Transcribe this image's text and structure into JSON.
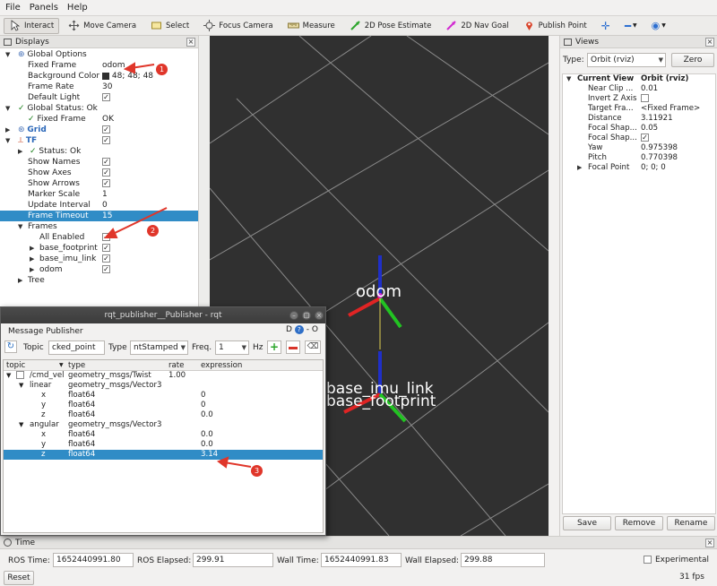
{
  "menu": [
    "File",
    "Panels",
    "Help"
  ],
  "toolbar": {
    "tools": [
      {
        "label": "Interact",
        "icon": "interact-icon"
      },
      {
        "label": "Move Camera",
        "icon": "move-camera-icon"
      },
      {
        "label": "Select",
        "icon": "select-icon"
      },
      {
        "label": "Focus Camera",
        "icon": "focus-camera-icon"
      },
      {
        "label": "Measure",
        "icon": "measure-icon"
      },
      {
        "label": "2D Pose Estimate",
        "icon": "pose-estimate-icon"
      },
      {
        "label": "2D Nav Goal",
        "icon": "nav-goal-icon"
      },
      {
        "label": "Publish Point",
        "icon": "publish-point-icon"
      }
    ]
  },
  "displays": {
    "title": "Displays",
    "rows": [
      {
        "key": "Global Options",
        "value": ""
      },
      {
        "key": "Fixed Frame",
        "value": "odom"
      },
      {
        "key": "Background Color",
        "value": "48; 48; 48"
      },
      {
        "key": "Frame Rate",
        "value": "30"
      },
      {
        "key": "Default Light",
        "value": ""
      },
      {
        "key": "Global Status: Ok",
        "value": ""
      },
      {
        "key": "Fixed Frame",
        "value": "OK"
      },
      {
        "key": "Grid",
        "value": ""
      },
      {
        "key": "TF",
        "value": ""
      },
      {
        "key": "Status: Ok",
        "value": ""
      },
      {
        "key": "Show Names",
        "value": ""
      },
      {
        "key": "Show Axes",
        "value": ""
      },
      {
        "key": "Show Arrows",
        "value": ""
      },
      {
        "key": "Marker Scale",
        "value": "1"
      },
      {
        "key": "Update Interval",
        "value": "0"
      },
      {
        "key": "Frame Timeout",
        "value": "15"
      },
      {
        "key": "Frames",
        "value": ""
      },
      {
        "key": "All Enabled",
        "value": ""
      },
      {
        "key": "base_footprint",
        "value": ""
      },
      {
        "key": "base_imu_link",
        "value": ""
      },
      {
        "key": "odom",
        "value": ""
      },
      {
        "key": "Tree",
        "value": ""
      }
    ]
  },
  "scene": {
    "labels": [
      "odom",
      "base_imu_link",
      "base_footprint"
    ]
  },
  "views": {
    "title": "Views",
    "type_label": "Type:",
    "type_value": "Orbit (rviz)",
    "zero_label": "Zero",
    "rows": [
      {
        "key": "Current View",
        "value": "Orbit (rviz)"
      },
      {
        "key": "Near Clip ...",
        "value": "0.01"
      },
      {
        "key": "Invert Z Axis",
        "value": ""
      },
      {
        "key": "Target Fra...",
        "value": "<Fixed Frame>"
      },
      {
        "key": "Distance",
        "value": "3.11921"
      },
      {
        "key": "Focal Shap...",
        "value": "0.05"
      },
      {
        "key": "Focal Shap...",
        "value": ""
      },
      {
        "key": "Yaw",
        "value": "0.975398"
      },
      {
        "key": "Pitch",
        "value": "0.770398"
      },
      {
        "key": "Focal Point",
        "value": "0; 0; 0"
      }
    ],
    "save_label": "Save",
    "remove_label": "Remove",
    "rename_label": "Rename"
  },
  "time": {
    "title": "Time",
    "ros_time_label": "ROS Time:",
    "ros_time": "1652440991.80",
    "ros_elapsed_label": "ROS Elapsed:",
    "ros_elapsed": "299.91",
    "wall_time_label": "Wall Time:",
    "wall_time": "1652440991.83",
    "wall_elapsed_label": "Wall Elapsed:",
    "wall_elapsed": "299.88",
    "experimental_label": "Experimental",
    "reset_label": "Reset",
    "fps": "31 fps"
  },
  "rqt": {
    "window_title": "rqt_publisher__Publisher - rqt",
    "plugin_title": "Message Publisher",
    "topic_label": "Topic",
    "topic_value": "cked_point",
    "type_label": "Type",
    "type_value": "ntStamped",
    "freq_label": "Freq.",
    "freq_value": "1",
    "hz_label": "Hz",
    "headers": [
      "topic",
      "type",
      "rate",
      "expression"
    ],
    "rows": [
      {
        "topic": "/cmd_vel",
        "type": "geometry_msgs/Twist",
        "rate": "1.00",
        "expression": ""
      },
      {
        "topic": "linear",
        "type": "geometry_msgs/Vector3",
        "rate": "",
        "expression": ""
      },
      {
        "topic": "x",
        "type": "float64",
        "rate": "",
        "expression": "0"
      },
      {
        "topic": "y",
        "type": "float64",
        "rate": "",
        "expression": "0"
      },
      {
        "topic": "z",
        "type": "float64",
        "rate": "",
        "expression": "0.0"
      },
      {
        "topic": "angular",
        "type": "geometry_msgs/Vector3",
        "rate": "",
        "expression": ""
      },
      {
        "topic": "x",
        "type": "float64",
        "rate": "",
        "expression": "0.0"
      },
      {
        "topic": "y",
        "type": "float64",
        "rate": "",
        "expression": "0.0"
      },
      {
        "topic": "z",
        "type": "float64",
        "rate": "",
        "expression": "3.14"
      }
    ]
  },
  "annotations": [
    "1",
    "2",
    "3"
  ],
  "colors": {
    "selection": "#308cc6",
    "scene_bg": "#303030",
    "annotation": "#e0362a"
  }
}
